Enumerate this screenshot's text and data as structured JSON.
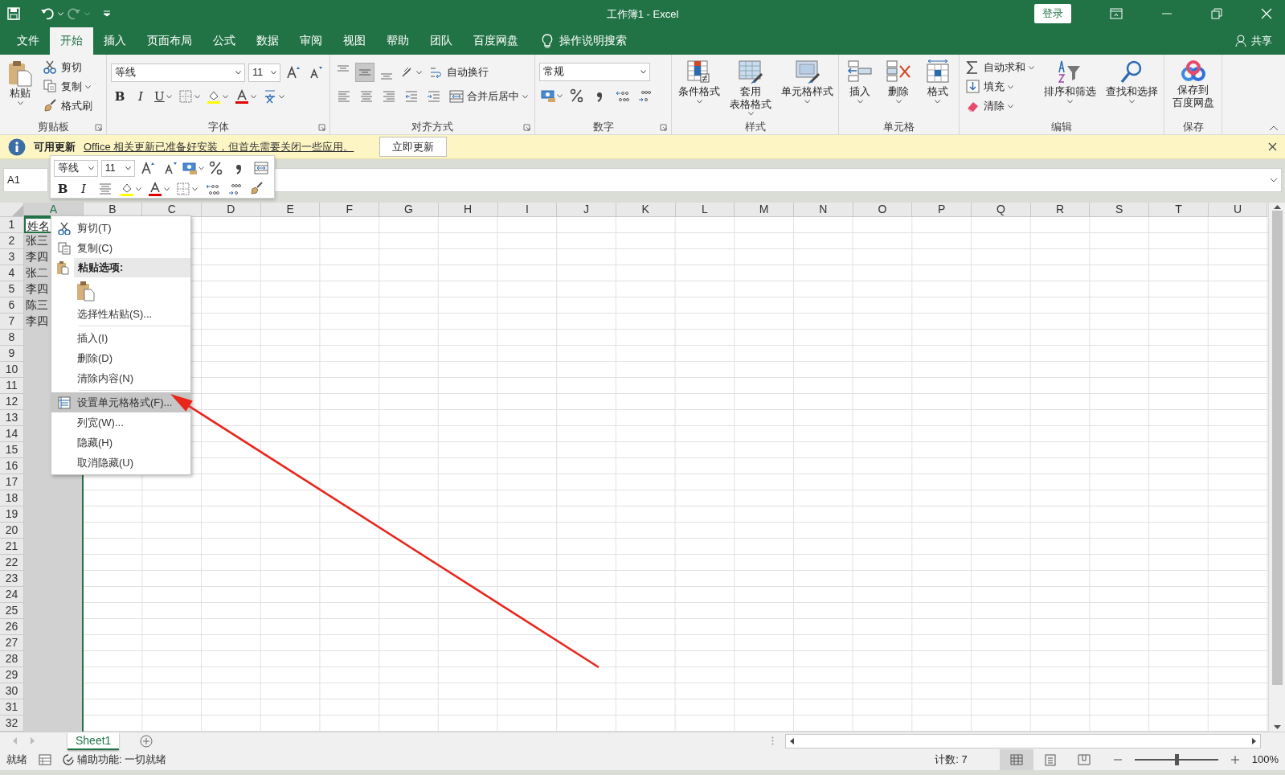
{
  "window": {
    "title": "工作簿1  -  Excel",
    "login": "登录"
  },
  "ribbon_tabs": [
    {
      "label": "文件",
      "selected": false
    },
    {
      "label": "开始",
      "selected": true
    },
    {
      "label": "插入",
      "selected": false
    },
    {
      "label": "页面布局",
      "selected": false
    },
    {
      "label": "公式",
      "selected": false
    },
    {
      "label": "数据",
      "selected": false
    },
    {
      "label": "审阅",
      "selected": false
    },
    {
      "label": "视图",
      "selected": false
    },
    {
      "label": "帮助",
      "selected": false
    },
    {
      "label": "团队",
      "selected": false
    },
    {
      "label": "百度网盘",
      "selected": false
    }
  ],
  "tell_me": "操作说明搜索",
  "share": "共享",
  "clipboard": {
    "label": "剪贴板",
    "paste": "粘贴",
    "cut": "剪切",
    "copy": "复制",
    "format_painter": "格式刷"
  },
  "font": {
    "label": "字体",
    "name": "等线",
    "size": "11",
    "bold": "B",
    "italic": "I",
    "underline": "U"
  },
  "alignment": {
    "label": "对齐方式",
    "vertical": [
      {
        "selected": false
      },
      {
        "selected": true
      },
      {
        "selected": false
      }
    ],
    "wrap": "自动换行",
    "merge": "合并后居中"
  },
  "number": {
    "label": "数字",
    "format": "常规"
  },
  "styles": {
    "label": "样式",
    "buttons": [
      {
        "lines": [
          "条件格式"
        ]
      },
      {
        "lines": [
          "套用",
          "表格格式"
        ]
      },
      {
        "lines": [
          "单元格样式"
        ]
      }
    ]
  },
  "cells": {
    "label": "单元格",
    "buttons": [
      "插入",
      "删除",
      "格式"
    ]
  },
  "editing": {
    "label": "编辑",
    "autosum": "自动求和",
    "fill": "填充",
    "clear": "清除",
    "sort": "排序和筛选",
    "find": "查找和选择"
  },
  "save": {
    "label": "保存",
    "lines": [
      "保存到",
      "百度网盘"
    ]
  },
  "info_bar": {
    "title": "可用更新",
    "message": "Office 相关更新已准备好安装，但首先需要关闭一些应用。",
    "button": "立即更新"
  },
  "formula_bar": {
    "name_box": "A1"
  },
  "mini_toolbar": {
    "font": "等线",
    "size": "11",
    "bold": "B",
    "italic": "I"
  },
  "sheet": {
    "columns": [
      {
        "label": "A",
        "selected": true
      },
      {
        "label": "B",
        "selected": false
      },
      {
        "label": "C",
        "selected": false
      },
      {
        "label": "D",
        "selected": false
      },
      {
        "label": "E",
        "selected": false
      },
      {
        "label": "F",
        "selected": false
      },
      {
        "label": "G",
        "selected": false
      },
      {
        "label": "H",
        "selected": false
      },
      {
        "label": "I",
        "selected": false
      },
      {
        "label": "J",
        "selected": false
      },
      {
        "label": "K",
        "selected": false
      },
      {
        "label": "L",
        "selected": false
      },
      {
        "label": "M",
        "selected": false
      },
      {
        "label": "N",
        "selected": false
      },
      {
        "label": "O",
        "selected": false
      },
      {
        "label": "P",
        "selected": false
      },
      {
        "label": "Q",
        "selected": false
      },
      {
        "label": "R",
        "selected": false
      },
      {
        "label": "S",
        "selected": false
      },
      {
        "label": "T",
        "selected": false
      },
      {
        "label": "U",
        "selected": false
      }
    ],
    "row_numbers": [
      "1",
      "2",
      "3",
      "4",
      "5",
      "6",
      "7",
      "8",
      "9",
      "10",
      "11",
      "12",
      "13",
      "14",
      "15",
      "16",
      "17",
      "18",
      "19",
      "20",
      "21",
      "22",
      "23",
      "24",
      "25",
      "26",
      "27",
      "28",
      "29",
      "30",
      "31",
      "32"
    ],
    "column_a": [
      "姓名",
      "张三",
      "李四",
      "张二",
      "李四",
      "陈三",
      "李四"
    ]
  },
  "context_menu": [
    {
      "kind": "cut",
      "label": "剪切(T)",
      "selected": false
    },
    {
      "kind": "copy",
      "label": "复制(C)",
      "selected": false
    },
    {
      "kind": "header",
      "label": "粘贴选项:"
    },
    {
      "kind": "paste_option",
      "selected": false
    },
    {
      "kind": "plain",
      "label": "选择性粘贴(S)...",
      "selected": false
    },
    {
      "kind": "separator"
    },
    {
      "kind": "plain",
      "label": "插入(I)",
      "selected": false
    },
    {
      "kind": "plain",
      "label": "删除(D)",
      "selected": false
    },
    {
      "kind": "plain",
      "label": "清除内容(N)",
      "selected": false
    },
    {
      "kind": "separator"
    },
    {
      "kind": "format_cells",
      "label": "设置单元格格式(F)...",
      "selected": true
    },
    {
      "kind": "plain",
      "label": "列宽(W)...",
      "selected": false
    },
    {
      "kind": "plain",
      "label": "隐藏(H)",
      "selected": false
    },
    {
      "kind": "plain",
      "label": "取消隐藏(U)",
      "selected": false
    }
  ],
  "sheet_tabs": [
    {
      "label": "Sheet1",
      "selected": true
    }
  ],
  "status_bar": {
    "ready": "就绪",
    "accessibility": "辅助功能: 一切就绪",
    "count": "计数: 7",
    "views": [
      {
        "selected": true
      },
      {
        "selected": false
      },
      {
        "selected": false
      }
    ],
    "zoom_slider": {
      "level": 0.5
    },
    "zoom": "100%"
  }
}
